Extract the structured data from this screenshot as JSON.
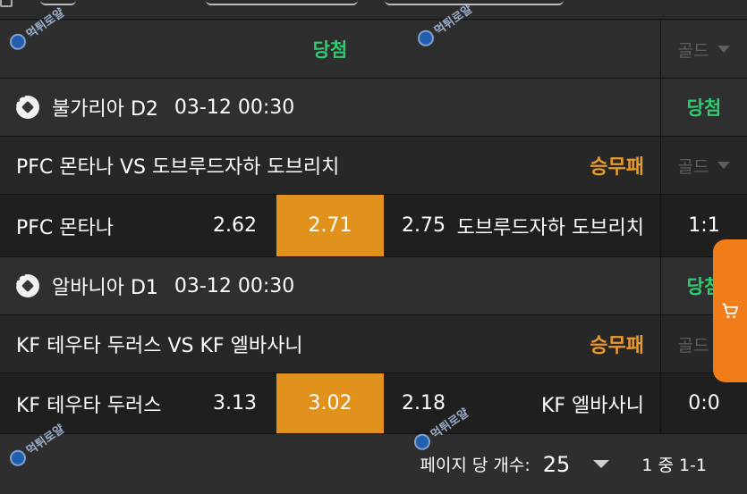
{
  "status_row": {
    "status": "당첨",
    "dropdown": "골드"
  },
  "matches": [
    {
      "league": "불가리아 D2",
      "datetime": "03-12 00:30",
      "result": "당첨",
      "title": "PFC 몬타나 VS 도브루드자하 도브리치",
      "market": "승무패",
      "dropdown": "골드",
      "home_team": "PFC 몬타나",
      "home_odd": "2.62",
      "draw_odd": "2.71",
      "away_odd": "2.75",
      "away_team": "도브루드자하 도브리치",
      "score": "1:1"
    },
    {
      "league": "알바니아 D1",
      "datetime": "03-12 00:30",
      "result": "당첨",
      "title": "KF 테우타 두러스 VS KF 엘바사니",
      "market": "승무패",
      "dropdown": "골드",
      "home_team": "KF 테우타 두러스",
      "home_odd": "3.13",
      "draw_odd": "3.02",
      "away_odd": "2.18",
      "away_team": "KF 엘바사니",
      "score": "0:0"
    }
  ],
  "footer": {
    "per_page_label": "페이지 당 개수:",
    "per_page_value": "25",
    "range": "1 중 1-1"
  },
  "icons": {
    "cart": "shopping-cart-icon",
    "ball": "soccer-ball-icon",
    "dropdown": "chevron-down-icon"
  },
  "colors": {
    "win_green": "#2ecc71",
    "market_orange": "#e89a2b",
    "selected_odd_bg": "#e0921c",
    "cart_tab_bg": "#f07d1a"
  }
}
